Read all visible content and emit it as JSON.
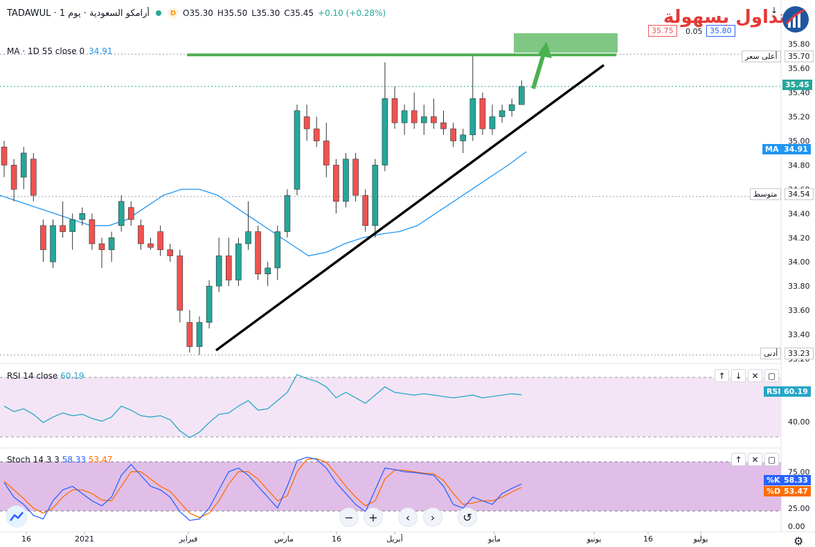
{
  "header": {
    "symbol_title": "أرامكو السعودية · يوم 1 · TADAWUL",
    "interval_badge": "D",
    "ohlc_open": "O35.30",
    "ohlc_high": "H35.50",
    "ohlc_low": "L35.30",
    "ohlc_close": "C35.45",
    "ohlc_change": "+0.10 (+0.28%)"
  },
  "trade_box": {
    "sell_price": "35.75",
    "spread": "0.05",
    "buy_price": "35.80"
  },
  "logo": {
    "text": "التداول بسهولة"
  },
  "ma_legend": {
    "label": "MA · 1D 55 close 0",
    "value": "34.91"
  },
  "price_axis": {
    "ticks": [
      "35.80",
      "35.60",
      "35.40",
      "35.20",
      "35.00",
      "34.80",
      "34.60",
      "34.40",
      "34.20",
      "34.00",
      "33.80",
      "33.60",
      "33.40",
      "33.20"
    ],
    "tags": {
      "high_label": "أعلى سعر",
      "high_value": "35.70",
      "last_value": "35.45",
      "ma_name": "MA",
      "ma_value": "34.91",
      "mid_label": "متوسط",
      "mid_value": "34.54",
      "low_label": "أدنى",
      "low_value": "33.23"
    }
  },
  "rsi": {
    "legend_label": "RSI 14 close",
    "legend_value": "60.19",
    "axis_tick": "40.00",
    "tag_name": "RSI",
    "tag_value": "60.19"
  },
  "stoch": {
    "legend_label": "Stoch 14 3 3",
    "k_value": "58.33",
    "d_value": "53.47",
    "axis_ticks": [
      "75.00",
      "50.00",
      "25.00",
      "0.00"
    ],
    "k_name": "%K",
    "d_name": "%D"
  },
  "time_axis": {
    "labels": [
      "16",
      "2021",
      "فبراير",
      "مارس",
      "16",
      "أبريل",
      "مايو",
      "يونيو",
      "16",
      "يوليو"
    ]
  },
  "controls": {
    "zoom_out": "−",
    "zoom_in": "+",
    "scroll_left": "‹",
    "scroll_right": "›",
    "reset": "↺"
  },
  "colors": {
    "up": "#26a69a",
    "down": "#ef5350",
    "ma": "#2196f3",
    "rsi_line": "#26a6c9",
    "rsi_band": "#f3e5f5",
    "stoch_band": "#e1bee7",
    "k_line": "#2962ff",
    "d_line": "#ff6d00",
    "resistance": "#4caf50",
    "trendline": "#000000"
  },
  "chart_data": {
    "type": "candlestick",
    "title": "أرامكو السعودية · يوم 1 · TADAWUL",
    "ylim": [
      33.2,
      35.85
    ],
    "series": [
      {
        "name": "MA 55",
        "values": [
          34.55,
          34.5,
          34.45,
          34.4,
          34.35,
          34.3,
          34.3,
          34.35,
          34.45,
          34.55,
          34.6,
          34.6,
          34.55,
          34.45,
          34.35,
          34.25,
          34.15,
          34.05,
          34.08,
          34.15,
          34.2,
          34.23,
          34.25,
          34.3,
          34.4,
          34.5,
          34.6,
          34.7,
          34.8,
          34.91
        ]
      }
    ],
    "candles": [
      {
        "o": 34.95,
        "h": 35.0,
        "l": 34.7,
        "c": 34.8
      },
      {
        "o": 34.8,
        "h": 34.85,
        "l": 34.5,
        "c": 34.6
      },
      {
        "o": 34.7,
        "h": 34.95,
        "l": 34.6,
        "c": 34.9
      },
      {
        "o": 34.85,
        "h": 34.9,
        "l": 34.5,
        "c": 34.55
      },
      {
        "o": 34.3,
        "h": 34.35,
        "l": 34.0,
        "c": 34.1
      },
      {
        "o": 34.0,
        "h": 34.35,
        "l": 33.95,
        "c": 34.3
      },
      {
        "o": 34.3,
        "h": 34.5,
        "l": 34.2,
        "c": 34.25
      },
      {
        "o": 34.25,
        "h": 34.4,
        "l": 34.1,
        "c": 34.35
      },
      {
        "o": 34.35,
        "h": 34.45,
        "l": 34.3,
        "c": 34.4
      },
      {
        "o": 34.35,
        "h": 34.4,
        "l": 34.1,
        "c": 34.15
      },
      {
        "o": 34.15,
        "h": 34.2,
        "l": 33.95,
        "c": 34.1
      },
      {
        "o": 34.1,
        "h": 34.25,
        "l": 34.0,
        "c": 34.2
      },
      {
        "o": 34.3,
        "h": 34.55,
        "l": 34.25,
        "c": 34.5
      },
      {
        "o": 34.45,
        "h": 34.5,
        "l": 34.3,
        "c": 34.35
      },
      {
        "o": 34.3,
        "h": 34.35,
        "l": 34.1,
        "c": 34.15
      },
      {
        "o": 34.15,
        "h": 34.2,
        "l": 34.1,
        "c": 34.12
      },
      {
        "o": 34.25,
        "h": 34.3,
        "l": 34.05,
        "c": 34.1
      },
      {
        "o": 34.1,
        "h": 34.15,
        "l": 34.0,
        "c": 34.05
      },
      {
        "o": 34.05,
        "h": 34.1,
        "l": 33.5,
        "c": 33.6
      },
      {
        "o": 33.5,
        "h": 33.6,
        "l": 33.25,
        "c": 33.3
      },
      {
        "o": 33.3,
        "h": 33.55,
        "l": 33.23,
        "c": 33.5
      },
      {
        "o": 33.5,
        "h": 33.85,
        "l": 33.45,
        "c": 33.8
      },
      {
        "o": 33.8,
        "h": 34.2,
        "l": 33.75,
        "c": 34.05
      },
      {
        "o": 34.05,
        "h": 34.2,
        "l": 33.8,
        "c": 33.85
      },
      {
        "o": 33.85,
        "h": 34.2,
        "l": 33.8,
        "c": 34.15
      },
      {
        "o": 34.15,
        "h": 34.5,
        "l": 34.1,
        "c": 34.25
      },
      {
        "o": 34.25,
        "h": 34.3,
        "l": 33.85,
        "c": 33.9
      },
      {
        "o": 33.9,
        "h": 34.0,
        "l": 33.8,
        "c": 33.95
      },
      {
        "o": 33.95,
        "h": 34.3,
        "l": 33.85,
        "c": 34.25
      },
      {
        "o": 34.25,
        "h": 34.6,
        "l": 34.2,
        "c": 34.55
      },
      {
        "o": 34.6,
        "h": 35.3,
        "l": 34.55,
        "c": 35.25
      },
      {
        "o": 35.2,
        "h": 35.3,
        "l": 35.0,
        "c": 35.1
      },
      {
        "o": 35.1,
        "h": 35.2,
        "l": 34.95,
        "c": 35.0
      },
      {
        "o": 35.0,
        "h": 35.15,
        "l": 34.7,
        "c": 34.8
      },
      {
        "o": 34.8,
        "h": 34.85,
        "l": 34.4,
        "c": 34.5
      },
      {
        "o": 34.5,
        "h": 34.9,
        "l": 34.45,
        "c": 34.85
      },
      {
        "o": 34.85,
        "h": 34.9,
        "l": 34.5,
        "c": 34.55
      },
      {
        "o": 34.55,
        "h": 34.6,
        "l": 34.25,
        "c": 34.3
      },
      {
        "o": 34.3,
        "h": 34.85,
        "l": 34.2,
        "c": 34.8
      },
      {
        "o": 34.8,
        "h": 35.65,
        "l": 34.75,
        "c": 35.35
      },
      {
        "o": 35.35,
        "h": 35.45,
        "l": 35.1,
        "c": 35.15
      },
      {
        "o": 35.15,
        "h": 35.3,
        "l": 35.05,
        "c": 35.25
      },
      {
        "o": 35.25,
        "h": 35.4,
        "l": 35.1,
        "c": 35.15
      },
      {
        "o": 35.15,
        "h": 35.3,
        "l": 35.05,
        "c": 35.2
      },
      {
        "o": 35.2,
        "h": 35.35,
        "l": 35.1,
        "c": 35.15
      },
      {
        "o": 35.15,
        "h": 35.25,
        "l": 35.05,
        "c": 35.1
      },
      {
        "o": 35.1,
        "h": 35.15,
        "l": 34.95,
        "c": 35.0
      },
      {
        "o": 35.0,
        "h": 35.1,
        "l": 34.9,
        "c": 35.05
      },
      {
        "o": 35.05,
        "h": 35.7,
        "l": 35.0,
        "c": 35.35
      },
      {
        "o": 35.35,
        "h": 35.4,
        "l": 35.05,
        "c": 35.1
      },
      {
        "o": 35.1,
        "h": 35.3,
        "l": 35.05,
        "c": 35.2
      },
      {
        "o": 35.2,
        "h": 35.3,
        "l": 35.15,
        "c": 35.25
      },
      {
        "o": 35.25,
        "h": 35.35,
        "l": 35.2,
        "c": 35.3
      },
      {
        "o": 35.3,
        "h": 35.5,
        "l": 35.3,
        "c": 35.45
      }
    ],
    "rsi_values": [
      52,
      48,
      50,
      46,
      40,
      44,
      47,
      45,
      46,
      43,
      41,
      44,
      52,
      49,
      45,
      44,
      45,
      42,
      34,
      29,
      33,
      40,
      46,
      47,
      52,
      56,
      49,
      50,
      56,
      62,
      75,
      72,
      70,
      66,
      58,
      62,
      58,
      54,
      60,
      66,
      62,
      61,
      60,
      61,
      60,
      59,
      58,
      59,
      60,
      58,
      59,
      60,
      61,
      60.19
    ],
    "stoch_k": [
      60,
      40,
      30,
      15,
      10,
      35,
      50,
      55,
      45,
      35,
      28,
      40,
      70,
      85,
      70,
      55,
      50,
      40,
      20,
      8,
      10,
      25,
      50,
      75,
      80,
      70,
      55,
      40,
      25,
      55,
      90,
      95,
      92,
      80,
      60,
      45,
      30,
      20,
      50,
      80,
      78,
      75,
      74,
      72,
      70,
      55,
      30,
      25,
      40,
      35,
      30,
      45,
      52,
      58.33
    ],
    "stoch_d": [
      62,
      50,
      38,
      25,
      18,
      25,
      40,
      50,
      50,
      45,
      36,
      35,
      55,
      75,
      75,
      65,
      55,
      48,
      33,
      18,
      12,
      18,
      35,
      58,
      75,
      75,
      65,
      50,
      35,
      42,
      75,
      92,
      93,
      88,
      72,
      55,
      40,
      28,
      35,
      65,
      77,
      77,
      75,
      73,
      72,
      63,
      45,
      30,
      32,
      35,
      35,
      40,
      47,
      53.47
    ],
    "resistance": 35.7,
    "xlabels": [
      "16",
      "2021",
      "فبراير",
      "مارس",
      "16",
      "أبريل",
      "مايو",
      "يونيو",
      "16",
      "يوليو"
    ]
  }
}
